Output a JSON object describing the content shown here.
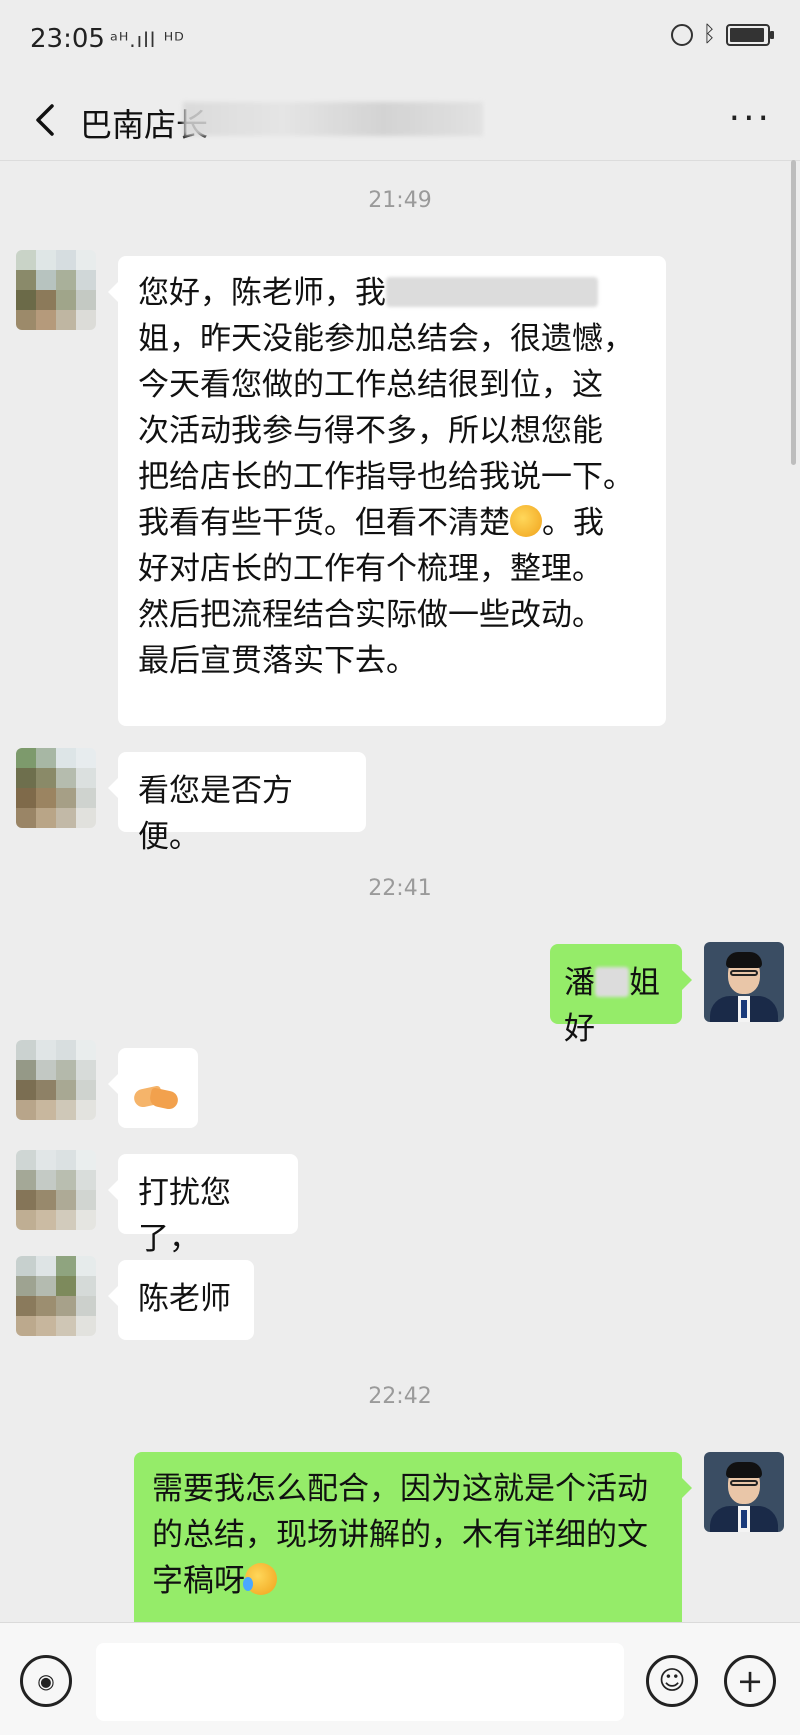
{
  "status_bar": {
    "time": "23:05",
    "signal": "ᵃᴴ.ıll ᴴᴰ"
  },
  "header": {
    "title": "巴南店长",
    "more": "···"
  },
  "messages": {
    "t1": "21:49",
    "m1_a": "您好，陈老师，我",
    "m1_b": "姐，昨天没能参加总结会，很遗憾，",
    "m1_c": "今天看您做的工作总结很到位，这",
    "m1_d": "次活动我参与得不多，所以想您能",
    "m1_e": "把给店长的工作指导也给我说一下。",
    "m1_f": "我看有些干货。但看不清楚",
    "m1_f2": "。我",
    "m1_g": "好对店长的工作有个梳理，整理。",
    "m1_h": "然后把流程结合实际做一些改动。",
    "m1_i": "最后宣贯落实下去。",
    "m2": "看您是否方便。",
    "t2": "22:41",
    "m3_a": "潘",
    "m3_b": "姐好",
    "m5": "打扰您了，",
    "m6": "陈老师",
    "t3": "22:42",
    "m7_a": "需要我怎么配合，因为这就是个活动",
    "m7_b": "的总结，现场讲解的，木有详细的文",
    "m7_c": "字稿呀"
  },
  "input": {
    "placeholder": ""
  },
  "icons": {
    "back": "back-arrow-icon",
    "more": "more-icon",
    "voice": "voice-icon",
    "emoji": "emoji-icon",
    "plus": "plus-icon"
  }
}
